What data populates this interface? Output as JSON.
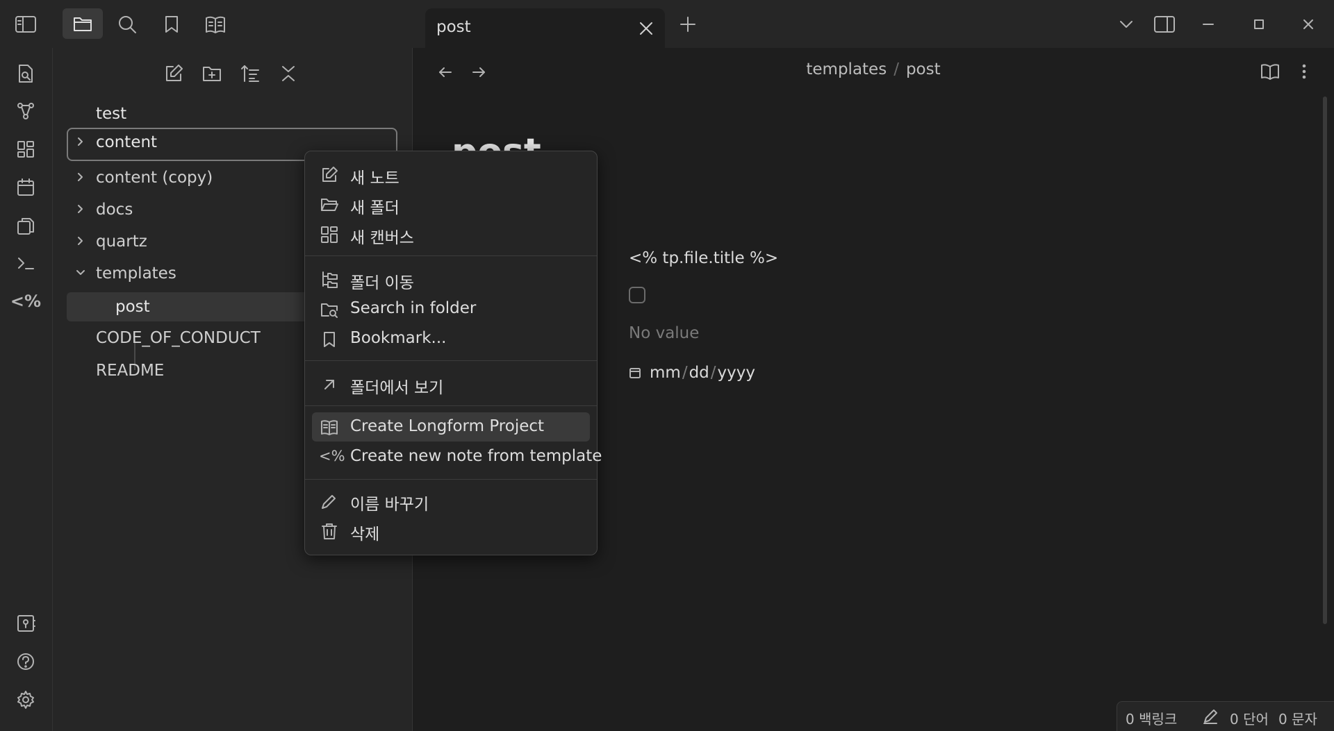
{
  "titlebar": {
    "tab_title": "post"
  },
  "sidebar": {
    "items": [
      {
        "label": "test",
        "type": "file"
      },
      {
        "label": "content",
        "type": "folder",
        "expanded": false,
        "focused": true
      },
      {
        "label": "content (copy)",
        "type": "folder",
        "expanded": false
      },
      {
        "label": "docs",
        "type": "folder",
        "expanded": false
      },
      {
        "label": "quartz",
        "type": "folder",
        "expanded": false
      },
      {
        "label": "templates",
        "type": "folder",
        "expanded": true
      },
      {
        "label": "post",
        "type": "file",
        "active": true
      },
      {
        "label": "CODE_OF_CONDUCT",
        "type": "file"
      },
      {
        "label": "README",
        "type": "file"
      }
    ]
  },
  "editor": {
    "breadcrumb": {
      "folder": "templates",
      "separator": "/",
      "file": "post"
    },
    "note_title": "post",
    "props": {
      "title_value": "<% tp.file.title %>",
      "empty_value": "No value",
      "date_mm": "mm",
      "date_dd": "dd",
      "date_yyyy": "yyyy",
      "date_sep": "/"
    }
  },
  "context_menu": {
    "items": [
      {
        "label": "새 노트",
        "icon": "edit-icon"
      },
      {
        "label": "새 폴더",
        "icon": "folder-open-icon"
      },
      {
        "label": "새 캔버스",
        "icon": "canvas-icon"
      },
      {
        "label": "폴더 이동",
        "icon": "folder-tree-icon"
      },
      {
        "label": "Search in folder",
        "icon": "folder-search-icon"
      },
      {
        "label": "Bookmark...",
        "icon": "bookmark-icon"
      },
      {
        "label": "폴더에서 보기",
        "icon": "arrow-up-right-icon"
      },
      {
        "label": "Create Longform Project",
        "icon": "book-icon",
        "highlighted": true
      },
      {
        "label": "Create new note from template",
        "icon_text": "<%"
      },
      {
        "label": "이름 바꾸기",
        "icon": "pencil-icon"
      },
      {
        "label": "삭제",
        "icon": "trash-icon"
      }
    ]
  },
  "statusbar": {
    "backlinks": "0 백링크",
    "words": "0 단어",
    "chars": "0 문자"
  },
  "ribbon": {
    "templater_label": "<%"
  }
}
